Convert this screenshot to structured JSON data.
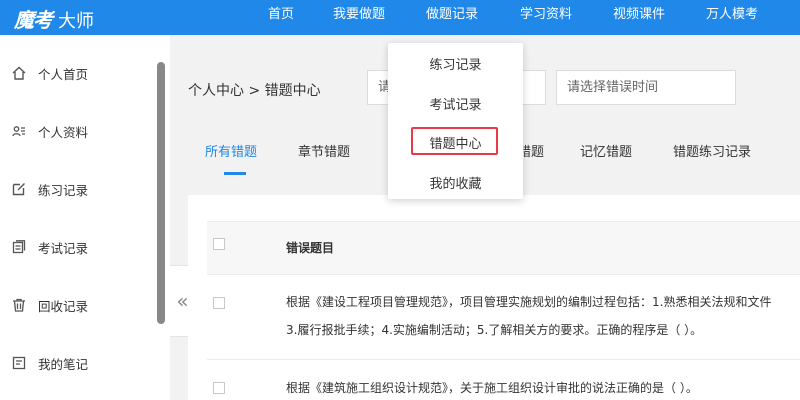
{
  "brand": {
    "logo_cursive": "魔考",
    "logo_plain": "大师"
  },
  "nav": {
    "items": [
      "首页",
      "我要做题",
      "做题记录",
      "学习资料",
      "视频课件",
      "万人模考"
    ]
  },
  "dropdown": {
    "items": [
      "练习记录",
      "考试记录",
      "错题中心",
      "我的收藏"
    ],
    "highlighted": "错题中心"
  },
  "sidebar": {
    "items": [
      {
        "label": "个人首页",
        "icon": "home-icon"
      },
      {
        "label": "个人资料",
        "icon": "user-card-icon"
      },
      {
        "label": "练习记录",
        "icon": "edit-icon"
      },
      {
        "label": "考试记录",
        "icon": "document-icon"
      },
      {
        "label": "回收记录",
        "icon": "trash-icon"
      },
      {
        "label": "我的笔记",
        "icon": "note-icon"
      }
    ]
  },
  "collapse": {
    "glyph": "«"
  },
  "breadcrumb": "个人中心 > 错题中心",
  "filters": {
    "subject_partial": "请",
    "error_time_placeholder": "请选择错误时间"
  },
  "tabs": {
    "items": [
      "所有错题",
      "章节错题",
      "错题",
      "记忆错题",
      "错题练习记录"
    ],
    "active": "所有错题"
  },
  "table": {
    "header": "错误题目",
    "rows": [
      {
        "line1": "根据《建设工程项目管理规范》，项目管理实施规划的编制过程包括：1.熟悉相关法规和文件",
        "line2": "3.履行报批手续；4.实施编制活动；5.了解相关方的要求。正确的程序是（ ）。"
      },
      {
        "line1": "根据《建筑施工组织设计规范》，关于施工组织设计审批的说法正确的是（ ）。"
      }
    ]
  },
  "colors": {
    "primary": "#1f88e8",
    "highlight": "#e83a4a"
  }
}
